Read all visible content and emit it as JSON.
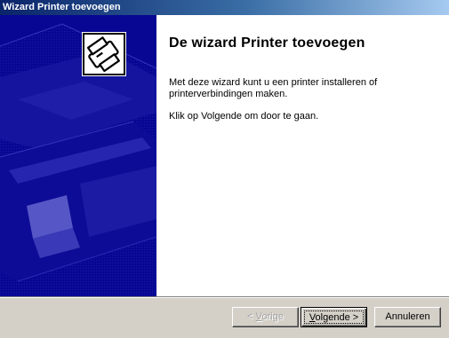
{
  "window": {
    "title": "Wizard Printer toevoegen"
  },
  "banner": {
    "icon": "printer-wizard-icon",
    "background_color": "#070793"
  },
  "main": {
    "heading": "De wizard Printer toevoegen",
    "intro": "Met deze wizard kunt u een printer installeren of printerverbindingen maken.",
    "instruction": "Klik op Volgende om door te gaan."
  },
  "buttons": {
    "back": {
      "prefix": "< ",
      "mnemonic": "V",
      "rest": "orige",
      "enabled": false
    },
    "next": {
      "mnemonic": "V",
      "rest": "olgende >",
      "enabled": true,
      "default": true
    },
    "cancel": {
      "label": "Annuleren",
      "enabled": true
    }
  }
}
